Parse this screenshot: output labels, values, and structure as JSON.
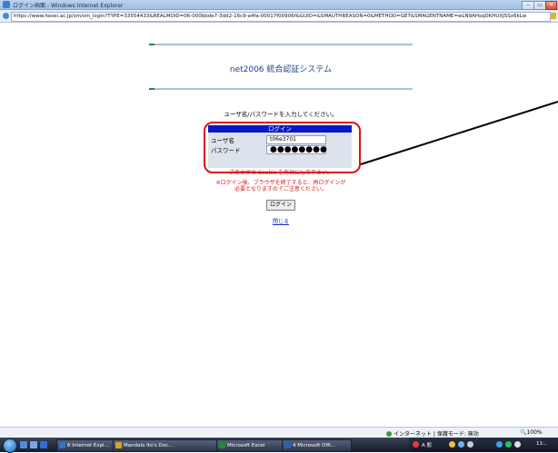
{
  "window": {
    "title": "ログイン画面 - Windows Internet Explorer",
    "url": "https://www.hosei.ac.jp/sm/sm_login?TYPE=33554433&REALMOID=06-000bbde7-3dd2-16c9-a4fa-00017f00906f&GUID=&SMAUTHREASON=0&METHOD=GET&SMAGENTNAME=wLN9AHsqDKHUXJSSx6kLw",
    "min_label": "–",
    "max_label": "▭",
    "close_label": "✕"
  },
  "page": {
    "system_title": "net2006 統合認証システム",
    "instruction": "ユーザ名/パスワードを入力してください。",
    "login_header": "ログイン",
    "username_label": "ユーザ名",
    "username_value": "t06e3701",
    "password_label": "パスワード",
    "password_value": "●●●●●●●●",
    "cookie_note": "ブラウザの Cookie を有効にして下さい。",
    "warning_line1": "※ログイン後、ブラウザを終了すると、再ログインが",
    "warning_line2": "必要となりますのでご注意ください。",
    "login_button": "ログイン",
    "close_link": "閉じる"
  },
  "statusbar": {
    "zone": "インターネット | 保護モード: 無効",
    "zoom": "100%"
  },
  "taskbar": {
    "items": [
      {
        "label": "6 Internet Expl...",
        "color": "#2f6fd1"
      },
      {
        "label": "Mandalo Ito's Doc...",
        "color": "#d8a12b"
      },
      {
        "label": "Microsoft Excel",
        "color": "#1f8a3b"
      },
      {
        "label": "4 Microsoft Offi...",
        "color": "#2c5fb8"
      }
    ],
    "tray_time": "11:..",
    "tray_lang": "A 般"
  },
  "colors": {
    "accent_blue": "#0a17c8",
    "highlight_red": "#e01010",
    "warning_red": "#d21c1c"
  }
}
